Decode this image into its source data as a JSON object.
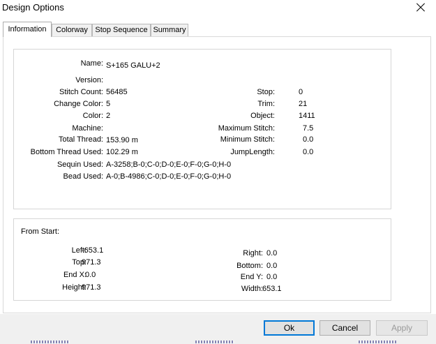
{
  "window": {
    "title": "Design Options"
  },
  "tabs": [
    {
      "label": "Information",
      "active": true
    },
    {
      "label": "Colorway",
      "active": false
    },
    {
      "label": "Stop Sequence",
      "active": false
    },
    {
      "label": "Summary",
      "active": false
    }
  ],
  "info": {
    "name_label": "Name:",
    "name_value": "S+165 GALU+2",
    "version_label": "Version:",
    "version_value": "",
    "stitch_count_label": "Stitch Count:",
    "stitch_count_value": "56485",
    "change_color_label": "Change Color:",
    "change_color_value": "5",
    "color_label": "Color:",
    "color_value": "2",
    "machine_label": "Machine:",
    "machine_value": "",
    "total_thread_label": "Total Thread:",
    "total_thread_value": "153.90 m",
    "bottom_thread_label": "Bottom Thread Used:",
    "bottom_thread_value": "102.29 m",
    "sequin_label": "Sequin Used:",
    "sequin_value": "A-3258;B-0;C-0;D-0;E-0;F-0;G-0;H-0",
    "bead_label": "Bead Used:",
    "bead_value": "A-0;B-4986;C-0;D-0;E-0;F-0;G-0;H-0",
    "stop_label": "Stop:",
    "stop_value": "0",
    "trim_label": "Trim:",
    "trim_value": "21",
    "object_label": "Object:",
    "object_value": "1411",
    "max_stitch_label": "Maximum Stitch:",
    "max_stitch_value": "7.5",
    "min_stitch_label": "Minimum Stitch:",
    "min_stitch_value": "0.0",
    "jump_length_label": "JumpLength:",
    "jump_length_value": "0.0"
  },
  "from_start": {
    "title": "From Start:",
    "left_label": "Left:",
    "left_value": "-653.1",
    "top_label": "Top:",
    "top_value": "971.3",
    "endx_label": "End X:",
    "endx_value": "0.0",
    "height_label": "Height:",
    "height_value": "971.3",
    "right_label": "Right:",
    "right_value": "0.0",
    "bottom_label": "Bottom:",
    "bottom_value": "0.0",
    "endy_label": "End Y:",
    "endy_value": "0.0",
    "width_label": "Width:",
    "width_value": "653.1"
  },
  "buttons": {
    "ok": "Ok",
    "cancel": "Cancel",
    "apply": "Apply"
  }
}
